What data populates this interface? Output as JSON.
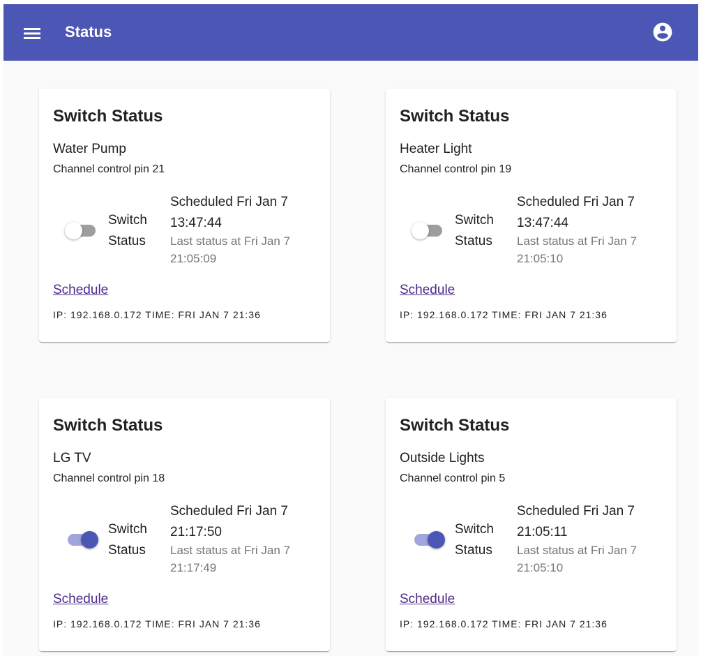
{
  "app_bar": {
    "title": "Status",
    "menu_icon": "menu-icon",
    "account_icon": "account-circle-icon",
    "color": "#4c56b4"
  },
  "cards": [
    {
      "title": "Switch Status",
      "device": "Water Pump",
      "channel": "Channel control pin 21",
      "switch_on": false,
      "switch_label": "Switch Status",
      "scheduled": "Scheduled Fri Jan 7 13:47:44",
      "last_status": "Last status at Fri Jan 7 21:05:09",
      "link": "Schedule",
      "info": "IP: 192.168.0.172 TIME: FRI JAN 7 21:36"
    },
    {
      "title": "Switch Status",
      "device": "Heater Light",
      "channel": "Channel control pin 19",
      "switch_on": false,
      "switch_label": "Switch Status",
      "scheduled": "Scheduled Fri Jan 7 13:47:44",
      "last_status": "Last status at Fri Jan 7 21:05:10",
      "link": "Schedule",
      "info": "IP: 192.168.0.172 TIME: FRI JAN 7 21:36"
    },
    {
      "title": "Switch Status",
      "device": "LG TV",
      "channel": "Channel control pin 18",
      "switch_on": true,
      "switch_label": "Switch Status",
      "scheduled": "Scheduled Fri Jan 7 21:17:50",
      "last_status": "Last status at Fri Jan 7 21:17:49",
      "link": "Schedule",
      "info": "IP: 192.168.0.172 TIME: FRI JAN 7 21:36"
    },
    {
      "title": "Switch Status",
      "device": "Outside Lights",
      "channel": "Channel control pin 5",
      "switch_on": true,
      "switch_label": "Switch Status",
      "scheduled": "Scheduled Fri Jan 7 21:05:11",
      "last_status": "Last status at Fri Jan 7 21:05:10",
      "link": "Schedule",
      "info": "IP: 192.168.0.172 TIME: FRI JAN 7 21:36"
    }
  ]
}
